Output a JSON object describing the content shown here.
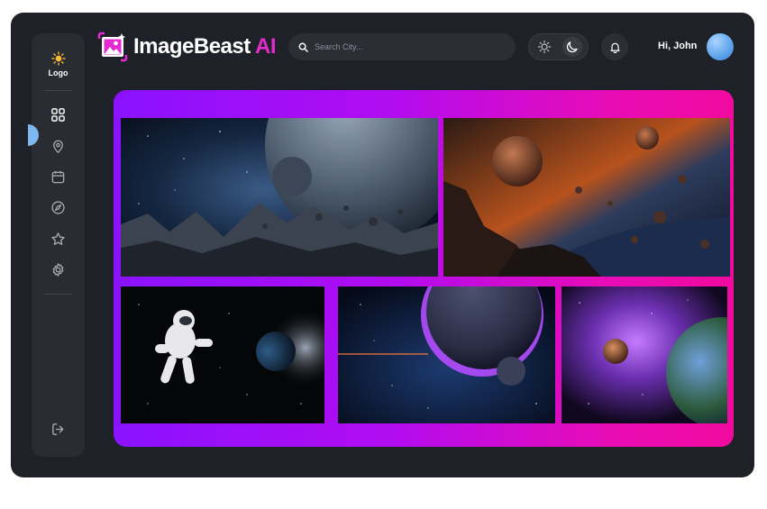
{
  "sidebar": {
    "logo_label": "Logo",
    "nav_items": [
      {
        "icon": "grid-icon",
        "active": true
      },
      {
        "icon": "location-pin-icon"
      },
      {
        "icon": "calendar-icon"
      },
      {
        "icon": "compass-icon"
      },
      {
        "icon": "star-icon"
      },
      {
        "icon": "gear-icon"
      }
    ],
    "logout_icon": "logout-icon"
  },
  "header": {
    "brand_name_part1": "ImageBeast",
    "brand_name_part2": " AI",
    "search_placeholder": "Search City...",
    "greeting": "Hi, John"
  },
  "theme": {
    "accent_magenta": "#e42bd0",
    "gradient_start": "#8a12ff",
    "gradient_end": "#f10a9e",
    "active_marker": "#7db8f0"
  },
  "gallery": {
    "images": [
      {
        "subject": "Planet over rocky mountains"
      },
      {
        "subject": "Asteroids near glowing planet"
      },
      {
        "subject": "Astronaut floating in space"
      },
      {
        "subject": "Purple cratered planet"
      },
      {
        "subject": "Nebula with planets"
      }
    ]
  }
}
